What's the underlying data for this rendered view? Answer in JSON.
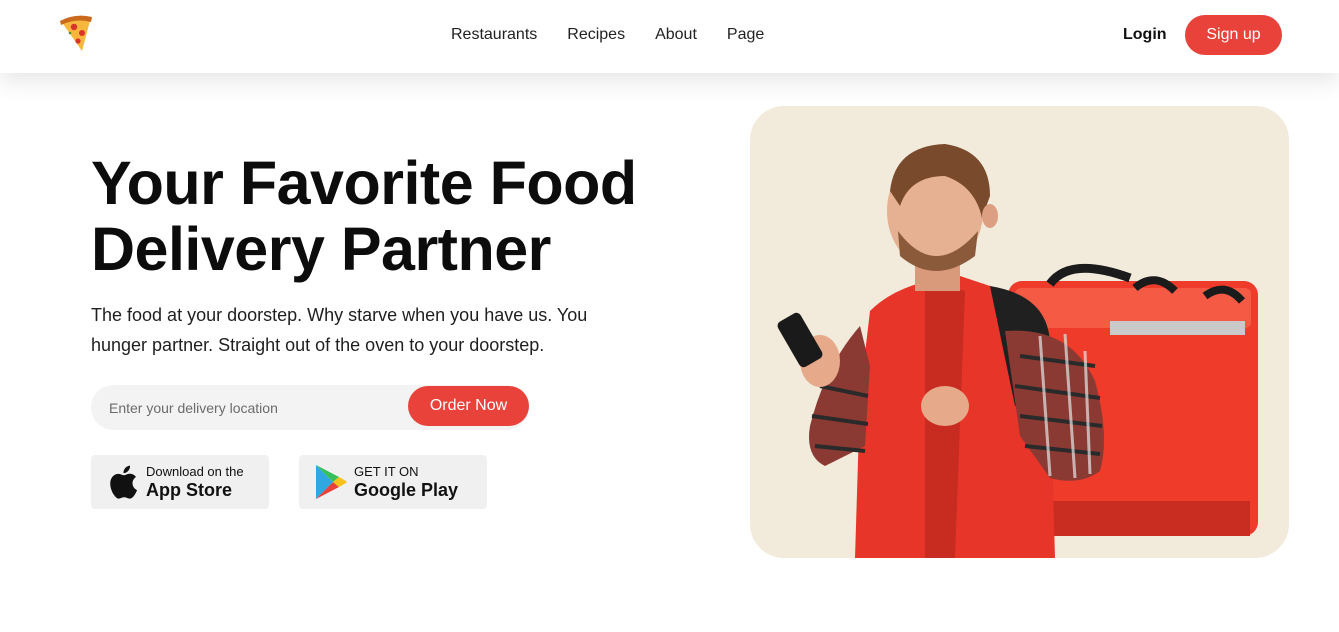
{
  "header": {
    "logo": "pizza-slice-logo",
    "nav": [
      "Restaurants",
      "Recipes",
      "About",
      "Page"
    ],
    "login_label": "Login",
    "signup_label": "Sign up"
  },
  "hero": {
    "title": "Your Favorite Food Delivery Partner",
    "subtitle": "The food at your doorstep. Why starve when you have us. You hunger partner. Straight out of the oven to your doorstep.",
    "search_placeholder": "Enter your delivery location",
    "search_value": "",
    "order_label": "Order Now",
    "app_store": {
      "small": "Download on the",
      "big": "App Store",
      "icon": "apple-icon"
    },
    "google_play": {
      "small": "GET IT ON",
      "big": "Google Play",
      "icon": "google-play-icon"
    },
    "image": "delivery-man-photo"
  },
  "colors": {
    "accent": "#e8423a",
    "card_bg": "#f2eadb",
    "input_bg": "#f3f3f3",
    "store_bg": "#f0f0f0"
  }
}
